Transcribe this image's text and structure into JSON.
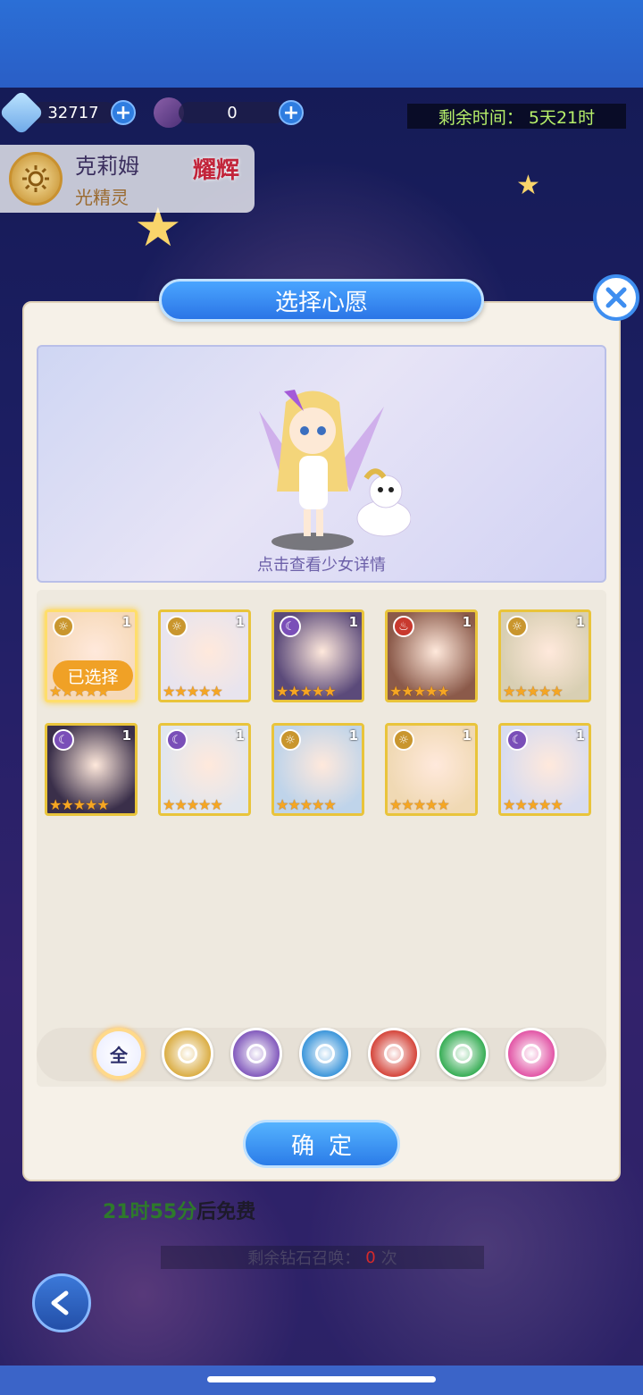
{
  "currency": {
    "gems": "32717",
    "tickets": "0"
  },
  "timer": {
    "label": "剩余时间：",
    "value": "5天21时"
  },
  "hero": {
    "name": "克莉姆",
    "subtitle": "光精灵",
    "rank": "耀辉"
  },
  "modal": {
    "title": "选择心愿",
    "preview_caption": "点击查看少女详情",
    "selected_label": "已选择",
    "confirm_label": "确定"
  },
  "cards": [
    {
      "element": "light",
      "level": "1",
      "stars": "★★★★★",
      "selected": true,
      "color": "#f6d9b8"
    },
    {
      "element": "light",
      "level": "1",
      "stars": "★★★★★",
      "selected": false,
      "color": "#e8e4ee"
    },
    {
      "element": "dark",
      "level": "1",
      "stars": "★★★★★",
      "selected": false,
      "color": "#5b4a7a"
    },
    {
      "element": "fire",
      "level": "1",
      "stars": "★★★★★",
      "selected": false,
      "color": "#8b5a4a"
    },
    {
      "element": "light",
      "level": "1",
      "stars": "★★★★★",
      "selected": false,
      "color": "#d8cfb3"
    },
    {
      "element": "dark",
      "level": "1",
      "stars": "★★★★★",
      "selected": false,
      "color": "#3a2f4a"
    },
    {
      "element": "dark",
      "level": "1",
      "stars": "★★★★★",
      "selected": false,
      "color": "#e1e6ee"
    },
    {
      "element": "light",
      "level": "1",
      "stars": "★★★★★",
      "selected": false,
      "color": "#bfd4ea"
    },
    {
      "element": "light",
      "level": "1",
      "stars": "★★★★★",
      "selected": false,
      "color": "#f0d9b4"
    },
    {
      "element": "dark",
      "level": "1",
      "stars": "★★★★★",
      "selected": false,
      "color": "#d8dcf0"
    }
  ],
  "filters": [
    {
      "name": "all",
      "label": "全",
      "color": "#eef0ff",
      "active": true
    },
    {
      "name": "light",
      "label": "",
      "color": "#d8a838",
      "active": false
    },
    {
      "name": "dark",
      "label": "",
      "color": "#7a4fb8",
      "active": false
    },
    {
      "name": "water",
      "label": "",
      "color": "#2f8fd8",
      "active": false
    },
    {
      "name": "fire",
      "label": "",
      "color": "#d2392e",
      "active": false
    },
    {
      "name": "wind",
      "label": "",
      "color": "#2aa84a",
      "active": false
    },
    {
      "name": "cosmic",
      "label": "",
      "color": "#e04aa0",
      "active": false
    }
  ],
  "footer": {
    "free_time": "21时55分",
    "free_suffix": "后免费",
    "summon_label": "剩余钻石召唤：",
    "summon_count": "0",
    "summon_unit": "次"
  }
}
